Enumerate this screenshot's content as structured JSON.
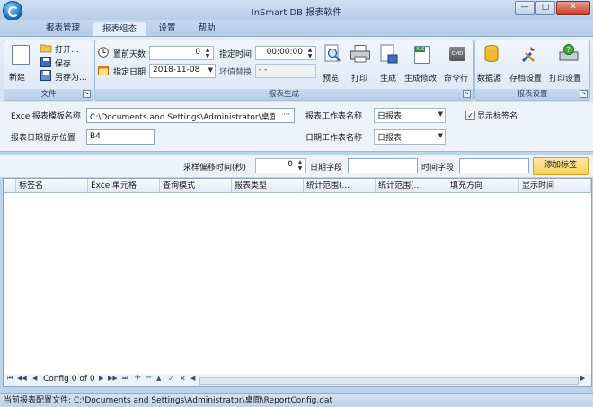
{
  "window": {
    "title": "InSmart DB 报表软件",
    "minimize_glyph": "—",
    "maximize_glyph": "□",
    "close_glyph": "✕",
    "accent_color": "#1466b8"
  },
  "tabs": [
    {
      "label": "报表管理"
    },
    {
      "label": "报表组态",
      "active": true
    },
    {
      "label": "设置"
    },
    {
      "label": "帮助"
    }
  ],
  "ribbon": {
    "file": {
      "group_label": "文件",
      "new_label": "新建",
      "open_label": "打开...",
      "save_label": "保存",
      "save_as_label": "另存为..."
    },
    "report_gen": {
      "group_label": "报表生成",
      "days_before_label": "置前天数",
      "days_before_value": "0",
      "spec_date_label": "指定日期",
      "spec_date_value": "2018-11-08",
      "spec_time_label": "指定时间",
      "spec_time_value": "00:00:00",
      "bad_value_label": "坏值替换",
      "bad_value_value": "- -",
      "preview_label": "预览",
      "print_label": "打印",
      "generate_label": "生成",
      "generate_modify_label": "生成修改",
      "command_label": "命令行",
      "cmd_icon_text": "CMD",
      "xls_icon_text": "XLS"
    },
    "report_settings": {
      "group_label": "报表设置",
      "datasource_label": "数据源",
      "archive_settings_label": "存档设置",
      "print_settings_label": "打印设置"
    }
  },
  "settings": {
    "template_label": "Excel报表模板名称",
    "template_value": "C:\\Documents and Settings\\Administrator\\桌面\\Re",
    "browse_label": "···",
    "date_pos_label": "报表日期显示位置",
    "date_pos_value": "B4",
    "sheet_label": "报表工作表名称",
    "sheet_value": "日报表",
    "show_tag_label": "显示标签名",
    "show_tag_checked": true,
    "check_glyph": "✓",
    "date_sheet_label": "日期工作表名称",
    "date_sheet_value": "日报表"
  },
  "grid_tools": {
    "offset_label": "采样偏移时间(秒)",
    "offset_value": "0",
    "date_field_label": "日期字段",
    "date_field_value": "",
    "time_field_label": "时间字段",
    "time_field_value": "",
    "add_tag_label": "添加标签"
  },
  "grid": {
    "columns": [
      {
        "label": "标签名"
      },
      {
        "label": "Excel单元格"
      },
      {
        "label": "查询模式"
      },
      {
        "label": "报表类型"
      },
      {
        "label": "统计范围(..."
      },
      {
        "label": "统计范围(..."
      },
      {
        "label": "填充方向"
      },
      {
        "label": "显示时间"
      }
    ]
  },
  "navigator": {
    "first": "⏮",
    "prev_page": "◀◀",
    "prev": "◀",
    "record_text": "Config 0 of 0",
    "next": "▶",
    "next_page": "▶▶",
    "last": "⏭",
    "add": "+",
    "delete": "−",
    "up": "▲",
    "confirm": "✓",
    "cancel": "✕",
    "scroll_left": "◀",
    "scroll_right": "▶"
  },
  "status": {
    "label": "当前报表配置文件:",
    "path": "C:\\Documents and Settings\\Administrator\\桌面\\ReportConfig.dat"
  }
}
